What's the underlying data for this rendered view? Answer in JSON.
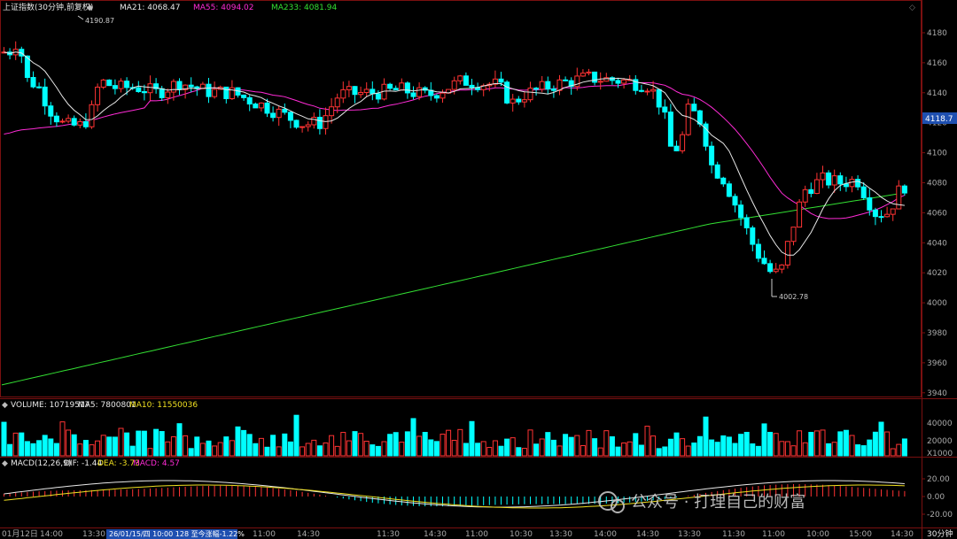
{
  "header": {
    "title": "上证指数(30分钟,前复权)",
    "ma": [
      {
        "label": "MA21: 4068.47",
        "color": "#e8e8e8"
      },
      {
        "label": "MA55: 4094.02",
        "color": "#ff2bd6"
      },
      {
        "label": "MA233: 4081.94",
        "color": "#33e033"
      }
    ]
  },
  "price_axis": {
    "ticks": [
      "4180",
      "4160",
      "4140",
      "4120",
      "4100",
      "4080",
      "4060",
      "4040",
      "4020",
      "4000",
      "3980",
      "3960",
      "3940"
    ],
    "current_tag": "4118.7"
  },
  "annotations": {
    "high": "4190.87",
    "low": "4002.78"
  },
  "volume_panel": {
    "header": [
      {
        "label": "VOLUME: 10719517",
        "color": "#e8e8e8"
      },
      {
        "label": "MA5: 7800801",
        "color": "#e8e8e8"
      },
      {
        "label": "MA10: 11550036",
        "color": "#f0e020"
      }
    ],
    "ticks": [
      "40000",
      "20000",
      "X1000"
    ]
  },
  "macd_panel": {
    "header": [
      {
        "label": "MACD(12,26,9)",
        "color": "#e8e8e8"
      },
      {
        "label": "DIF: -1.44",
        "color": "#e8e8e8"
      },
      {
        "label": "DEA: -3.73",
        "color": "#f0e020"
      },
      {
        "label": "MACD: 4.57",
        "color": "#ff2bd6"
      }
    ],
    "ticks": [
      "20.00",
      "0.00",
      "-20.00"
    ]
  },
  "time_axis": {
    "labels": [
      "01月12日",
      "14:00",
      "13:30",
      "14:00",
      "11:00",
      "14:30",
      "11:30",
      "14:30",
      "11:00",
      "10:30",
      "13:30",
      "14:00",
      "14:30",
      "13:30",
      "11:30",
      "11:00",
      "10:00",
      "15:00",
      "14:30",
      "14:00"
    ],
    "cursor_info": "26/01/15/四 10:00 128 至今涨幅-1.22%",
    "period": "30分钟"
  },
  "watermark": "公众号 · 打理自己的财富",
  "colors": {
    "up": "#ff3333",
    "down": "#00ffff",
    "grid": "#7a1010",
    "axis_bg": "#000000"
  }
}
